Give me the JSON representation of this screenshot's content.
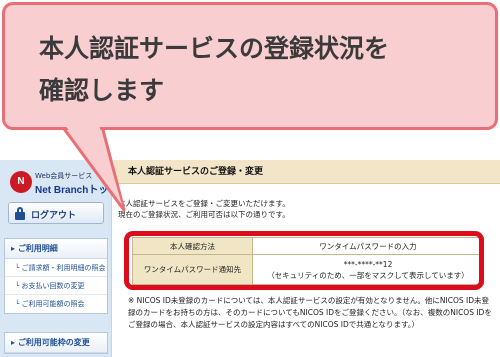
{
  "callout": {
    "text": "本人認証サービスの登録状況を\n確認します"
  },
  "sidebar": {
    "logo_mark": "N",
    "logo_sub": "Web会員サービス",
    "logo_main": "Net Branchトップ",
    "logout_label": "ログアウト",
    "menu_usage": {
      "head": "ご利用明細",
      "items": [
        "ご請求額・利用明細の照会",
        "お支払い回数の変更",
        "ご利用可能額の照会"
      ]
    },
    "menu_available": {
      "head": "ご利用可能枠の変更"
    }
  },
  "main": {
    "title": "本人認証サービスのご登録・変更",
    "intro_line1": "本人認証サービスをご登録・ご変更いただけます。",
    "intro_line2": "現在のご登録状況、ご利用可否は以下の通りです。",
    "table": {
      "row1_label": "本人確認方法",
      "row1_value": "ワンタイムパスワードの入力",
      "row2_label": "ワンタイムパスワード通知先",
      "row2_value_line1": "***-****-**12",
      "row2_value_line2": "（セキュリティのため、一部をマスクして表示しています）"
    },
    "note": "※ NICOS ID未登録のカードについては、本人認証サービスの設定が有効となりません。他にNICOS ID未登録のカードをお持ちの方は、そのカードについてもNICOS IDをご登録ください。（なお、複数のNICOS IDをご登録の場合、本人認証サービスの設定内容はすべてのNICOS IDで共通となります。）"
  },
  "colors": {
    "highlight_red": "#dc0c1c",
    "callout_fill": "#f9ced1",
    "callout_border": "#ea6e75",
    "sidebar_bg": "#d9e6f4",
    "title_bar_bg": "#f3e6c8",
    "brand_blue": "#1f4f95"
  }
}
